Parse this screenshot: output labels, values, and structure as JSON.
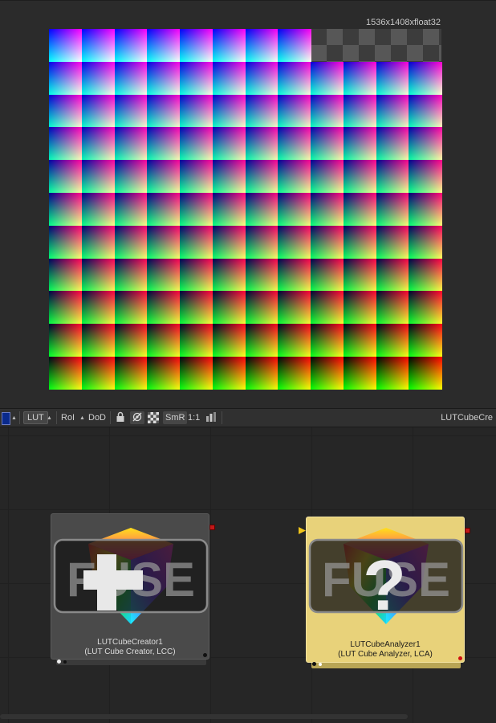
{
  "viewer": {
    "resolution_label": "1536x1408xfloat32",
    "lut_grid": {
      "columns": 12,
      "rows": 11,
      "visible_top_row_cells": 8
    }
  },
  "toolbar": {
    "lut_label": "LUT",
    "roi_label": "RoI",
    "dod_label": "DoD",
    "smr_label": "SmR",
    "scale_label": "1:1",
    "view_title": "LUTCubeCre",
    "swatch_color": "#0a2a8c"
  },
  "flow": {
    "nodes": [
      {
        "id": "creator",
        "name": "LUTCubeCreator1",
        "subtitle": "(LUT Cube Creator, LCC)",
        "fill": "#4a4a4a",
        "text_color": "#dddddd",
        "symbol": "+",
        "selected": false
      },
      {
        "id": "analyzer",
        "name": "LUTCubeAnalyzer1",
        "subtitle": "(LUT Cube Analyzer, LCA)",
        "fill": "#e8d27a",
        "text_color": "#1a1a1a",
        "symbol": "?",
        "selected": true
      }
    ],
    "logo_text": "FUSE",
    "port_color": "#c01818"
  }
}
